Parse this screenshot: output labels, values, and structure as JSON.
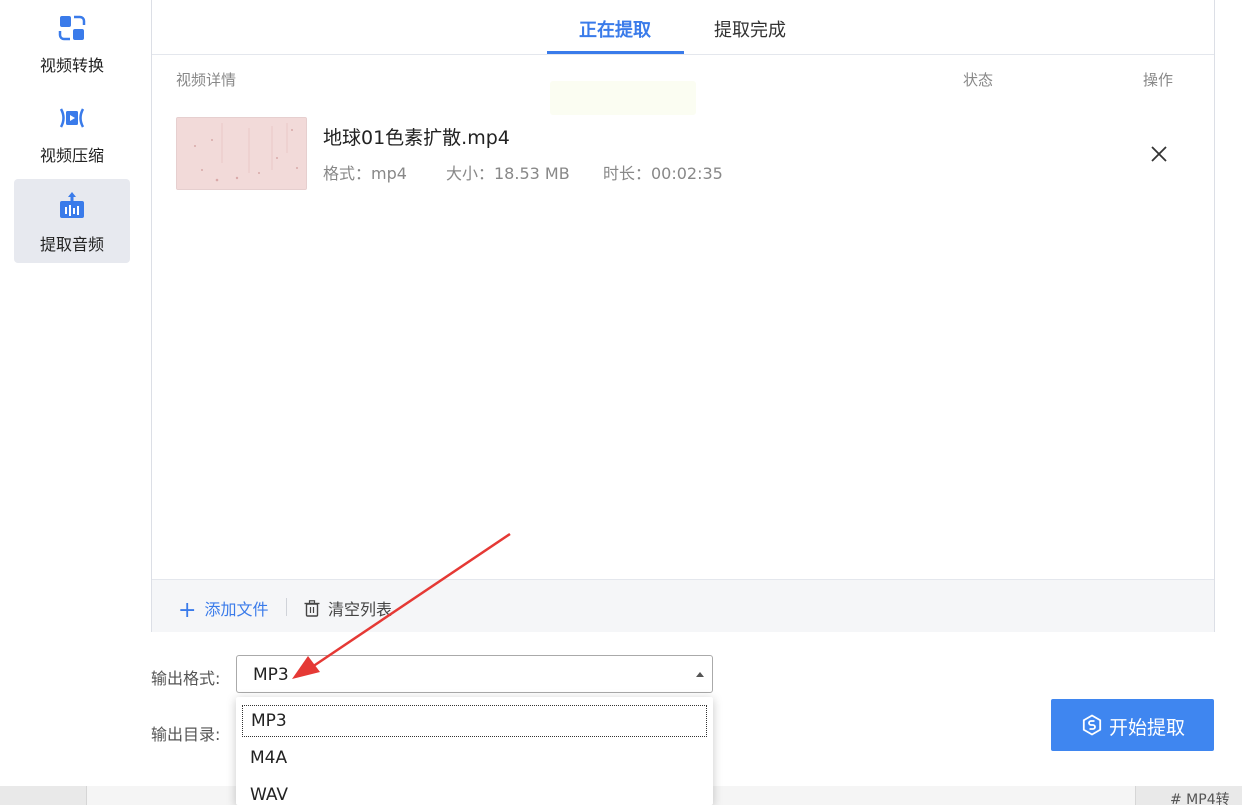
{
  "sidebar": {
    "items": [
      {
        "label": "视频转换",
        "icon": "convert-icon"
      },
      {
        "label": "视频压缩",
        "icon": "compress-icon"
      },
      {
        "label": "提取音频",
        "icon": "extract-audio-icon",
        "active": true
      }
    ]
  },
  "tabs": [
    {
      "label": "正在提取",
      "active": true
    },
    {
      "label": "提取完成",
      "active": false
    }
  ],
  "table": {
    "headers": {
      "details": "视频详情",
      "status": "状态",
      "action": "操作"
    },
    "rows": [
      {
        "filename": "地球01色素扩散.mp4",
        "format": "格式：mp4",
        "size": "大小：18.53 MB",
        "duration": "时长：00:02:35"
      }
    ]
  },
  "footer": {
    "add_file": "添加文件",
    "clear_list": "清空列表"
  },
  "output": {
    "format_label": "输出格式:",
    "format_value": "MP3",
    "dir_label": "输出目录:",
    "options": [
      "MP3",
      "M4A",
      "WAV"
    ]
  },
  "start_button": "开始提取",
  "background_text": "# MP4转",
  "colors": {
    "accent": "#3a7bea",
    "button": "#3f86f0",
    "annotation_arrow": "#e53935"
  }
}
